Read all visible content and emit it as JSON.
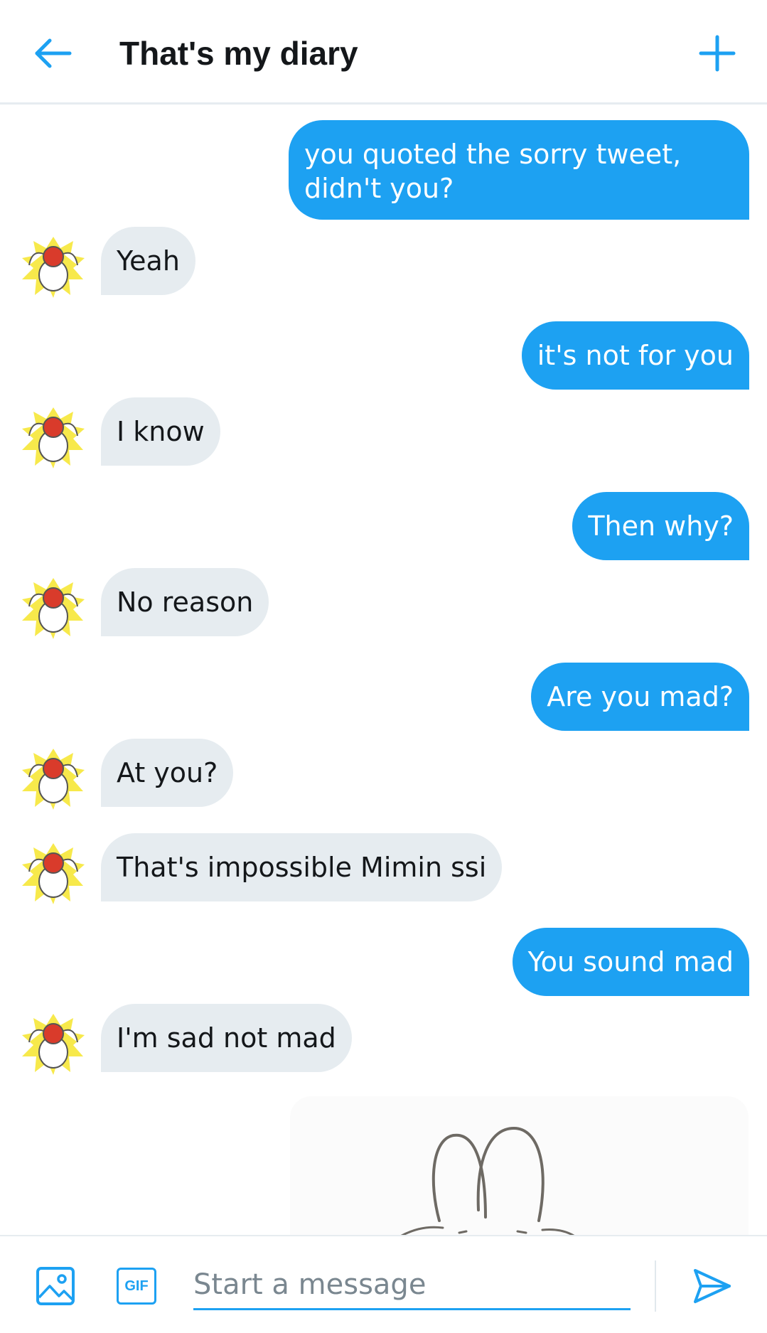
{
  "header": {
    "title": "That's my diary",
    "back_icon": "arrow-left-icon",
    "new_icon": "plus-icon"
  },
  "colors": {
    "accent": "#1da1f2",
    "incoming_bubble": "#e6ecf0",
    "text": "#14171a"
  },
  "messages": [
    {
      "direction": "outgoing",
      "text": "you quoted the sorry tweet, didn't you?"
    },
    {
      "direction": "incoming",
      "text": "Yeah"
    },
    {
      "direction": "outgoing",
      "text": "it's not for you"
    },
    {
      "direction": "incoming",
      "text": "I know"
    },
    {
      "direction": "outgoing",
      "text": "Then why?"
    },
    {
      "direction": "incoming",
      "text": "No reason"
    },
    {
      "direction": "outgoing",
      "text": "Are you mad?"
    },
    {
      "direction": "incoming",
      "text": "At you?"
    },
    {
      "direction": "incoming",
      "text": "That's impossible Mimin ssi"
    },
    {
      "direction": "outgoing",
      "text": "You sound mad"
    },
    {
      "direction": "incoming",
      "text": "I'm sad not mad"
    }
  ],
  "composer": {
    "placeholder": "Start a message",
    "gif_label": "GIF",
    "media_icon": "image-icon",
    "send_icon": "send-icon"
  }
}
